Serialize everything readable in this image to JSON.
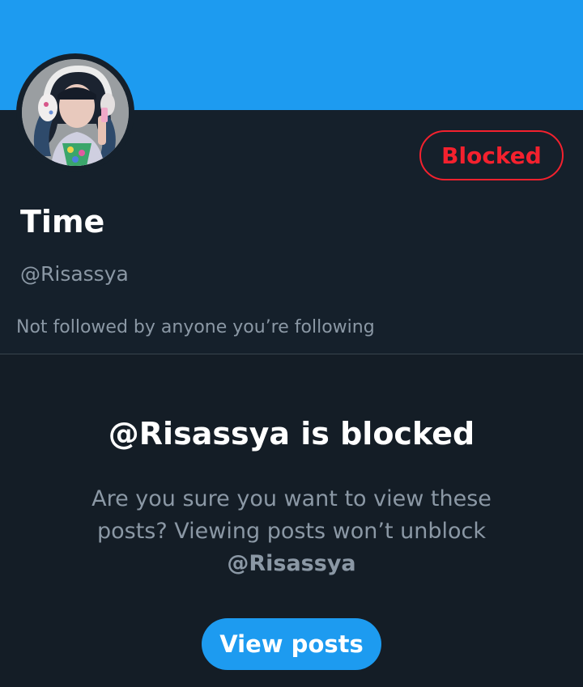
{
  "profile": {
    "display_name": "Time",
    "handle": "@Risassya",
    "followed_by": "Not followed by anyone you’re following",
    "blocked_label": "Blocked"
  },
  "blocked_notice": {
    "title": "@Risassya is blocked",
    "message": "Are you sure you want to view these posts? Viewing posts won’t unblock",
    "handle_mention": "@Risassya",
    "button_label": "View posts"
  },
  "colors": {
    "banner": "#1d9bf0",
    "background": "#15202b",
    "blocked_red": "#f4212e",
    "accent_blue": "#1d9bf0",
    "secondary_text": "#8b98a5"
  }
}
